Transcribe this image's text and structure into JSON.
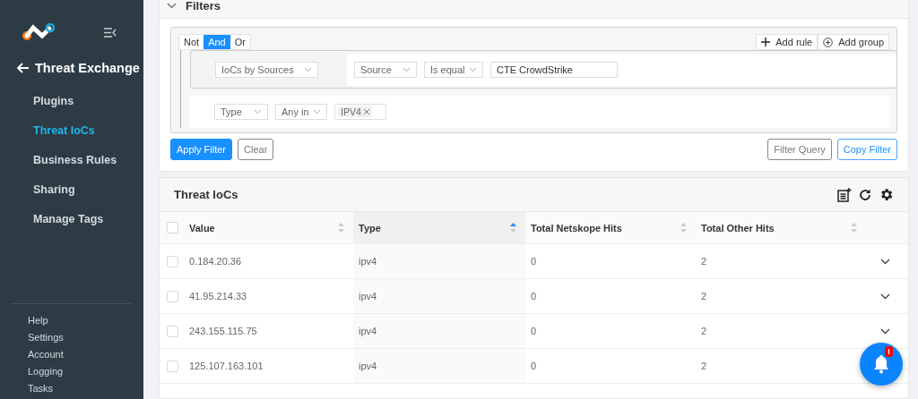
{
  "sidebar": {
    "back_title": "Threat Exchange",
    "items": [
      {
        "label": "Plugins",
        "selected": false
      },
      {
        "label": "Threat IoCs",
        "selected": true
      },
      {
        "label": "Business Rules",
        "selected": false
      },
      {
        "label": "Sharing",
        "selected": false
      },
      {
        "label": "Manage Tags",
        "selected": false
      }
    ],
    "footer_links": [
      "Help",
      "Settings",
      "Account",
      "Logging",
      "Tasks"
    ]
  },
  "filters": {
    "title": "Filters",
    "expanded": true,
    "conjunctions": [
      {
        "label": "Not",
        "selected": false
      },
      {
        "label": "And",
        "selected": true
      },
      {
        "label": "Or",
        "selected": false
      }
    ],
    "add_rule": "Add rule",
    "add_group": "Add group",
    "group_rule": {
      "field": "IoCs by Sources",
      "sub_field": "Source",
      "operator": "Is equal",
      "value": "CTE CrowdStrike"
    },
    "rule": {
      "field": "Type",
      "operator": "Any in",
      "tags": [
        "IPV4"
      ]
    },
    "apply": "Apply Filter",
    "clear": "Clear",
    "filter_query": "Filter Query",
    "copy_filter": "Copy Filter"
  },
  "table": {
    "title": "Threat IoCs",
    "all_checked": false,
    "columns": [
      {
        "label": "Value",
        "sorted": false
      },
      {
        "label": "Type",
        "sorted": true
      },
      {
        "label": "Total Netskope Hits",
        "sorted": false
      },
      {
        "label": "Total Other Hits",
        "sorted": false
      }
    ],
    "rows": [
      {
        "cells": [
          "0.184.20.36",
          "ipv4",
          "0",
          "2"
        ],
        "checked": false,
        "expanded": false
      },
      {
        "cells": [
          "41.95.214.33",
          "ipv4",
          "0",
          "2"
        ],
        "checked": false,
        "expanded": false
      },
      {
        "cells": [
          "243.155.115.75",
          "ipv4",
          "0",
          "2"
        ],
        "checked": false,
        "expanded": false
      },
      {
        "cells": [
          "125.107.163.101",
          "ipv4",
          "0",
          "2"
        ],
        "checked": false,
        "expanded": false
      }
    ]
  },
  "notification": {
    "badge": "!"
  }
}
